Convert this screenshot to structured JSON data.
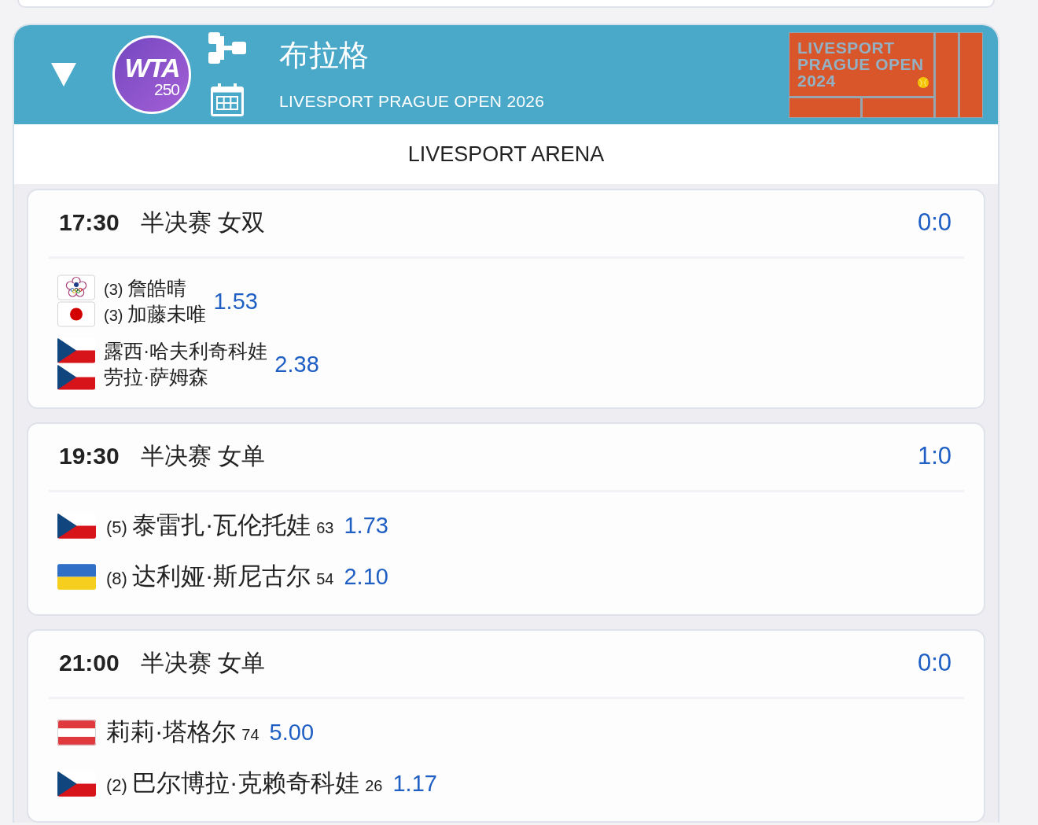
{
  "tournament": {
    "expanded": true,
    "badge": {
      "name": "WTA",
      "tier": "250"
    },
    "title": "布拉格",
    "subtitle": "LIVESPORT PRAGUE OPEN 2026",
    "logo": {
      "lines": [
        "LIVESPORT",
        "PRAGUE OPEN",
        "2024"
      ]
    }
  },
  "venue": "LIVESPORT ARENA",
  "matches": [
    {
      "time": "17:30",
      "round": "半决赛 女双",
      "score": "0:0",
      "kind": "doubles",
      "entries": [
        {
          "players": [
            {
              "flag": {
                "kind": "tpe"
              },
              "seed": "(3)",
              "name": "詹皓晴"
            },
            {
              "flag": {
                "kind": "japan"
              },
              "seed": "(3)",
              "name": "加藤未唯"
            }
          ],
          "odds": "1.53"
        },
        {
          "players": [
            {
              "flag": {
                "kind": "czechia"
              },
              "name": "露西·哈夫利奇科娃"
            },
            {
              "flag": {
                "kind": "czechia"
              },
              "name": "劳拉·萨姆森"
            }
          ],
          "odds": "2.38"
        }
      ]
    },
    {
      "time": "19:30",
      "round": "半决赛 女单",
      "score": "1:0",
      "kind": "singles",
      "entries": [
        {
          "flag": {
            "kind": "czechia"
          },
          "seed": "(5)",
          "name": "泰雷扎·瓦伦托娃",
          "rank": "63",
          "odds": "1.73"
        },
        {
          "flag": {
            "kind": "ukraine"
          },
          "seed": "(8)",
          "name": "达利娅·斯尼古尔",
          "rank": "54",
          "odds": "2.10"
        }
      ]
    },
    {
      "time": "21:00",
      "round": "半决赛 女单",
      "score": "0:0",
      "kind": "singles",
      "entries": [
        {
          "flag": {
            "kind": "austria"
          },
          "name": "莉莉·塔格尔",
          "rank": "74",
          "odds": "5.00"
        },
        {
          "flag": {
            "kind": "czechia"
          },
          "seed": "(2)",
          "name": "巴尔博拉·克赖奇科娃",
          "rank": "26",
          "odds": "1.17"
        }
      ]
    }
  ]
}
